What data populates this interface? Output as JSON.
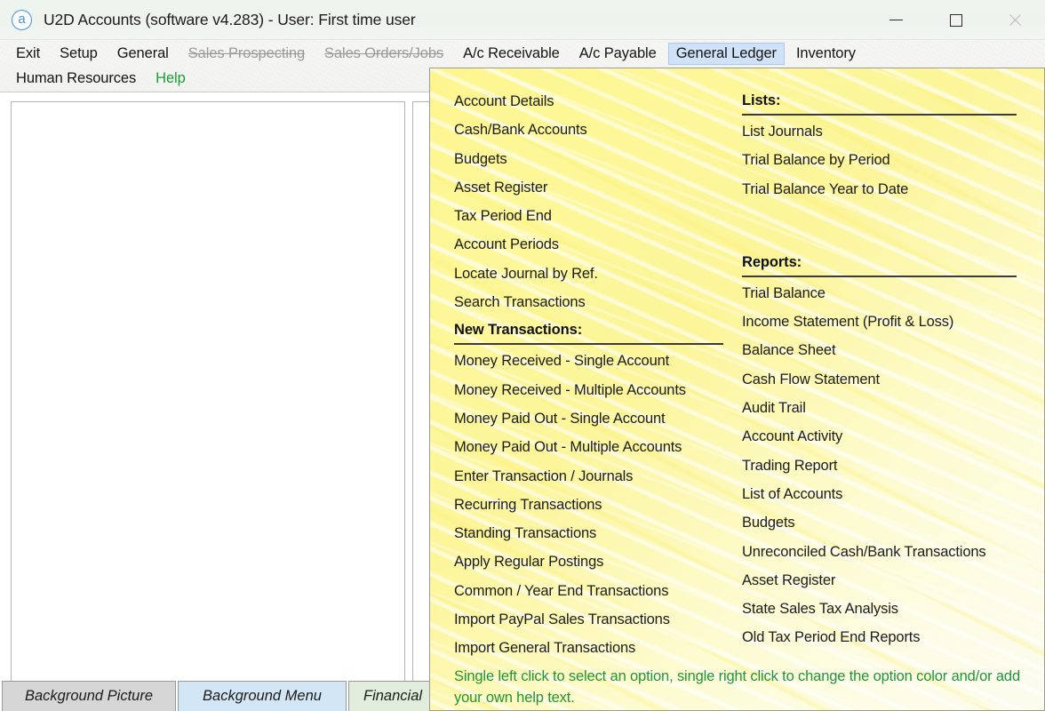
{
  "window": {
    "icon": "app-circle-a-icon",
    "title": "U2D Accounts (software v4.283) -  User: First time user",
    "controls": {
      "minimize": "minimize",
      "maximize": "maximize",
      "close": "close"
    }
  },
  "menubar": {
    "row1": [
      {
        "label": "Exit",
        "state": "normal"
      },
      {
        "label": "Setup",
        "state": "normal"
      },
      {
        "label": "General",
        "state": "normal"
      },
      {
        "label": "Sales Prospecting",
        "state": "disabled"
      },
      {
        "label": "Sales Orders/Jobs",
        "state": "disabled"
      },
      {
        "label": "A/c Receivable",
        "state": "normal"
      },
      {
        "label": "A/c Payable",
        "state": "normal"
      },
      {
        "label": "General Ledger",
        "state": "active"
      },
      {
        "label": "Inventory",
        "state": "normal"
      }
    ],
    "row2": [
      {
        "label": "Human Resources",
        "state": "normal"
      },
      {
        "label": "Help",
        "state": "help"
      }
    ]
  },
  "dropdown": {
    "left_column": [
      {
        "type": "item",
        "label": "Account Details"
      },
      {
        "type": "item",
        "label": "Cash/Bank Accounts"
      },
      {
        "type": "item",
        "label": "Budgets"
      },
      {
        "type": "item",
        "label": "Asset Register"
      },
      {
        "type": "item",
        "label": "Tax Period End"
      },
      {
        "type": "item",
        "label": "Account Periods"
      },
      {
        "type": "item",
        "label": "Locate Journal by Ref."
      },
      {
        "type": "item",
        "label": "Search Transactions"
      },
      {
        "type": "header",
        "label": "New Transactions:"
      },
      {
        "type": "item",
        "label": "Money Received - Single Account"
      },
      {
        "type": "item",
        "label": "Money Received - Multiple Accounts"
      },
      {
        "type": "item",
        "label": "Money Paid Out - Single Account"
      },
      {
        "type": "item",
        "label": "Money Paid Out - Multiple Accounts"
      },
      {
        "type": "item",
        "label": "Enter Transaction / Journals"
      },
      {
        "type": "item",
        "label": "Recurring Transactions"
      },
      {
        "type": "item",
        "label": "Standing Transactions"
      },
      {
        "type": "item",
        "label": "Apply Regular Postings"
      },
      {
        "type": "item",
        "label": "Common / Year End Transactions"
      },
      {
        "type": "item",
        "label": "Import PayPal Sales Transactions"
      },
      {
        "type": "item",
        "label": "Import General Transactions"
      }
    ],
    "right_column": [
      {
        "type": "header",
        "label": "Lists:"
      },
      {
        "type": "item",
        "label": "List Journals"
      },
      {
        "type": "item",
        "label": "Trial Balance by Period"
      },
      {
        "type": "item",
        "label": "Trial Balance Year to Date"
      },
      {
        "type": "gap"
      },
      {
        "type": "gap"
      },
      {
        "type": "gap"
      },
      {
        "type": "header",
        "label": "Reports:"
      },
      {
        "type": "item",
        "label": "Trial Balance"
      },
      {
        "type": "item",
        "label": "Income Statement (Profit & Loss)"
      },
      {
        "type": "item",
        "label": "Balance Sheet"
      },
      {
        "type": "item",
        "label": "Cash Flow Statement"
      },
      {
        "type": "item",
        "label": "Audit Trail"
      },
      {
        "type": "item",
        "label": "Account Activity"
      },
      {
        "type": "item",
        "label": "Trading Report"
      },
      {
        "type": "item",
        "label": "List of Accounts"
      },
      {
        "type": "item",
        "label": "Budgets"
      },
      {
        "type": "item",
        "label": "Unreconciled Cash/Bank Transactions"
      },
      {
        "type": "item",
        "label": "Asset Register"
      },
      {
        "type": "item",
        "label": "State Sales Tax Analysis"
      },
      {
        "type": "item",
        "label": "Old Tax Period End Reports"
      }
    ],
    "help_text": "Single left click to select an option, single right click to change the option color and/or add your own help text."
  },
  "tabs": [
    {
      "label": "Background Picture",
      "selected": false
    },
    {
      "label": "Background Menu",
      "selected": true
    },
    {
      "label": "Financial",
      "selected": false
    }
  ],
  "colors": {
    "menu_background": "#fdf79a",
    "active_menu": "#cfe2f7",
    "help_green": "#21943a",
    "selected_tab": "#d3e6f5"
  }
}
